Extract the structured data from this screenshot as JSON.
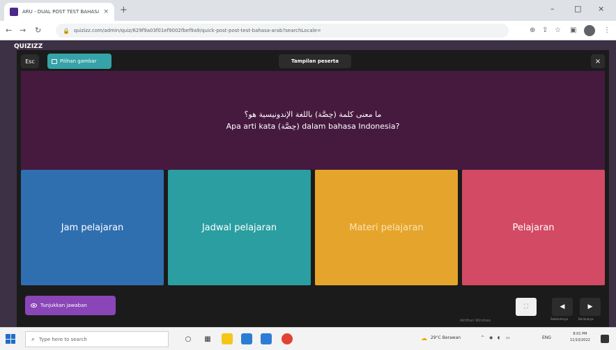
{
  "browser": {
    "tab_title": "ARU - DUAL POST TEST BAHASA",
    "tab_close": "×",
    "new_tab": "+",
    "window_controls": {
      "minimize": "–",
      "maximize": "□",
      "close": "×"
    },
    "nav": {
      "back": "←",
      "forward": "→",
      "reload": "↻"
    },
    "url": "quizizz.com/admin/quiz/629f9a03f01ef9002fbef9a9/quick-post-post-test-bahasa-arab?searchLocale="
  },
  "page": {
    "logo": "QUIZIZZ"
  },
  "modal": {
    "timer_label": "Esc",
    "theme_label": "Pilihan gambar",
    "participant_view_label": "Tampilan peserta",
    "close_label": "×",
    "question_arabic": "ما معنى كلمة (حِصَّة) باللغة الإندونيسية هو؟",
    "question_indonesian": "Apa arti kata (حِصَّة) dalam bahasa Indonesia?",
    "options": [
      {
        "label": "Jam pelajaran"
      },
      {
        "label": "Jadwal pelajaran"
      },
      {
        "label": "Materi pelajaran"
      },
      {
        "label": "Pelajaran"
      }
    ],
    "show_answer_label": "Tunjukkan jawaban",
    "controls": {
      "fullscreen_icon": "⛶",
      "prev_icon": "◀",
      "next_icon": "▶",
      "prev_label": "Sebelumnya",
      "next_label": "Berikutnya"
    },
    "activate_note": "Aktifkan Windows"
  },
  "taskbar": {
    "search_placeholder": "Type here to search",
    "weather": "29°C Berawan",
    "time": "8:01 PM",
    "date": "11/10/2022",
    "lang": "ENG"
  },
  "colors": {
    "question_bg": "#461a3f",
    "option1": "#2f6fb0",
    "option2": "#2a9ea0",
    "option3": "#e5a52c",
    "option4": "#d24a63",
    "theme_button": "#36a3a8",
    "show_answer_button": "#8a45b7"
  }
}
